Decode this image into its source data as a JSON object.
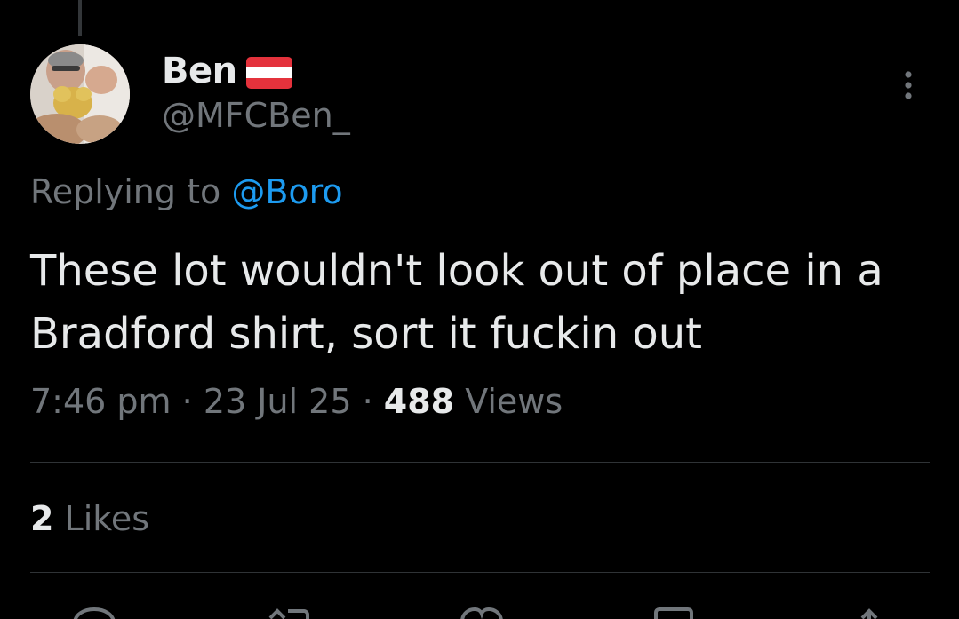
{
  "tweet": {
    "display_name": "Ben",
    "handle": "@MFCBen_",
    "replying_prefix": "Replying to ",
    "replying_mention": "@Boro",
    "text": "These lot wouldn't look out of place in a Bradford shirt, sort it fuckin out",
    "time": "7:46 pm",
    "separator": " · ",
    "date": "23 Jul 25",
    "views_count": "488",
    "views_label": " Views",
    "likes_count": "2",
    "likes_label": " Likes"
  },
  "icons": {
    "flag": "austria-flag-icon",
    "more": "more-options-icon",
    "actions": [
      "reply-icon",
      "repost-icon",
      "like-icon",
      "bookmark-icon",
      "share-icon"
    ]
  },
  "colors": {
    "background": "#000000",
    "primary_text": "#e7e9ea",
    "secondary_text": "#71767b",
    "link": "#1d9bf0",
    "divider": "#2f3336",
    "flag_red": "#e4323c",
    "flag_white": "#ffffff"
  }
}
